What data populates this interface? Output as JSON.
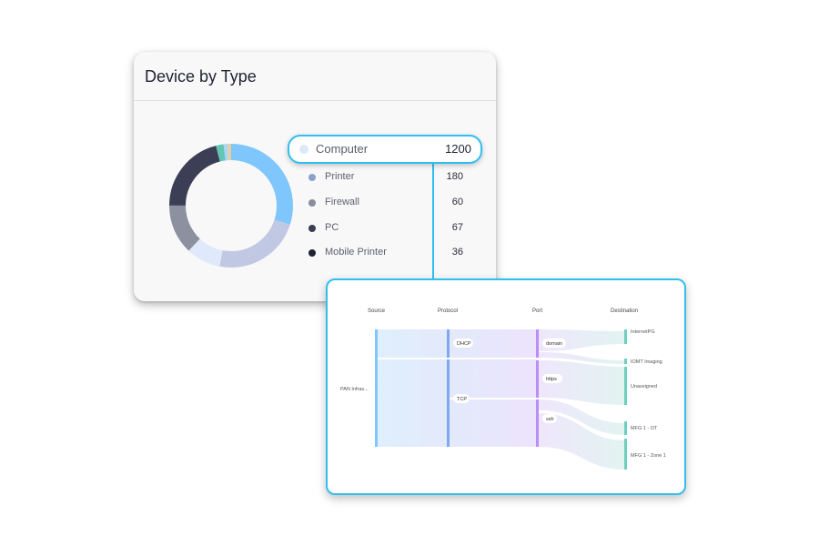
{
  "device_card": {
    "title": "Device by Type",
    "highlight": {
      "label": "Computer",
      "value": "1200",
      "color": "#dde8fa"
    },
    "legend": [
      {
        "label": "Printer",
        "value": "180",
        "color": "#8aa1c9"
      },
      {
        "label": "Firewall",
        "value": "60",
        "color": "#8a8d9c"
      },
      {
        "label": "PC",
        "value": "67",
        "color": "#3a3d52"
      },
      {
        "label": "Mobile Printer",
        "value": "36",
        "color": "#1f2330"
      }
    ],
    "donut_segments": [
      {
        "name": "light-blue",
        "value": 30,
        "color": "#7ec6fb"
      },
      {
        "name": "lavender",
        "value": 23,
        "color": "#c1c8e4"
      },
      {
        "name": "pale-blue",
        "value": 9,
        "color": "#dfe9fb"
      },
      {
        "name": "gray",
        "value": 13,
        "color": "#8d909e"
      },
      {
        "name": "dark-navy",
        "value": 21,
        "color": "#3b3e55"
      },
      {
        "name": "teal",
        "value": 2,
        "color": "#62c7b5"
      },
      {
        "name": "light-blue-2",
        "value": 1,
        "color": "#a9d7fa"
      },
      {
        "name": "beige",
        "value": 1,
        "color": "#e7cf9c"
      }
    ]
  },
  "sankey_card": {
    "columns": [
      {
        "label": "Source"
      },
      {
        "label": "Protocol"
      },
      {
        "label": "Port"
      },
      {
        "label": "Destination"
      }
    ],
    "source_label": "PAN Infras...",
    "protocols": [
      "DHCP",
      "TCP"
    ],
    "ports": [
      "domain",
      "https",
      "ssh"
    ],
    "destinations": [
      "InternetPG",
      "IOMT Imaging",
      "Unassigned",
      "MFG 1 - OT",
      "MFG 1 - Zone 1"
    ],
    "colors": {
      "source": "#7ec6fb",
      "protocol": "#7ea8ef",
      "port": "#b98ef5",
      "destination": "#6ccfc0",
      "accent": "#31bff0"
    }
  }
}
